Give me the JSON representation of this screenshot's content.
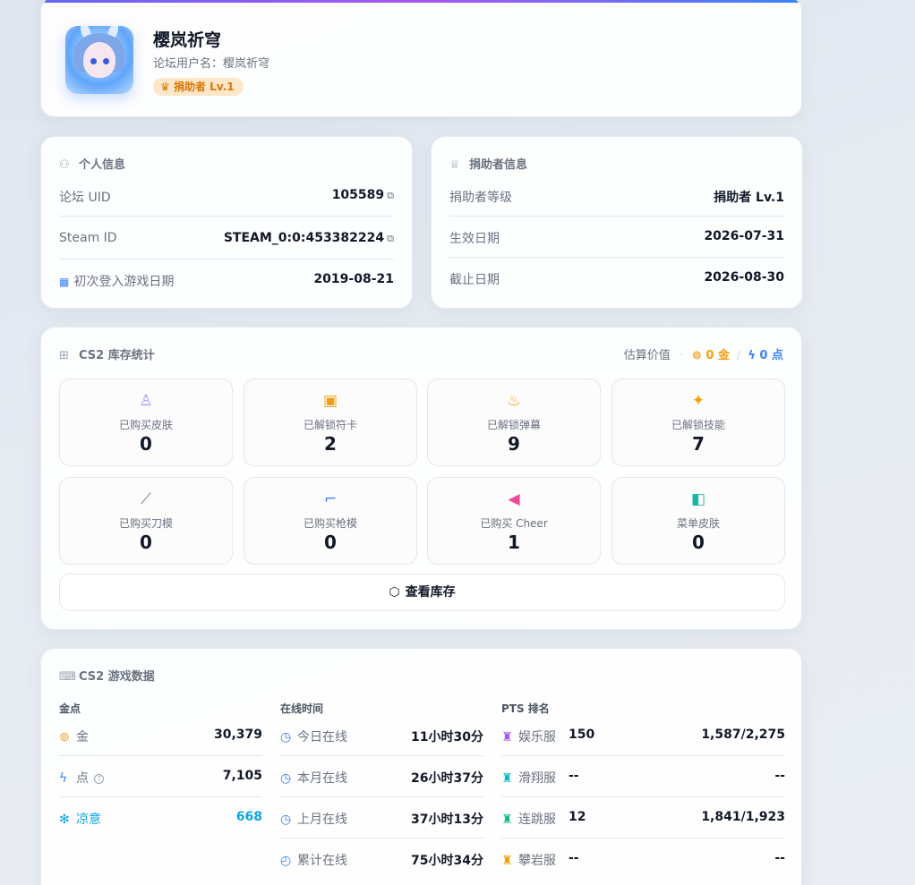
{
  "profile": {
    "username": "樱岚祈穹",
    "forum_name": "论坛用户名：樱岚祈穹",
    "badge": "捐助者 Lv.1"
  },
  "personal": {
    "title": "个人信息",
    "rows": [
      {
        "label": "论坛 UID",
        "value": "105589"
      },
      {
        "label": "Steam ID",
        "value": "STEAM_0:0:453382224"
      },
      {
        "label": "初次登入游戏日期",
        "value": "2019-08-21"
      }
    ]
  },
  "donor": {
    "title": "捐助者信息",
    "rows": [
      {
        "label": "捐助者等级",
        "value": "捐助者 Lv.1"
      },
      {
        "label": "生效日期",
        "value": "2026-07-31"
      },
      {
        "label": "截止日期",
        "value": "2026-08-30"
      }
    ]
  },
  "inventory": {
    "title": "CS2 库存统计",
    "estimate_label": "估算价值",
    "estimate_gold": "0 金",
    "estimate_points": "0 点",
    "tiles": [
      {
        "label": "已购买皮肤",
        "value": "0",
        "icon": "figure-icon",
        "color": "#a78bfa"
      },
      {
        "label": "已解锁符卡",
        "value": "2",
        "icon": "card-icon",
        "color": "#f59e0b"
      },
      {
        "label": "已解锁弹幕",
        "value": "9",
        "icon": "flame-icon",
        "color": "#f59e0b"
      },
      {
        "label": "已解锁技能",
        "value": "7",
        "icon": "sparkles-icon",
        "color": "#f59e0b"
      },
      {
        "label": "已购买刀模",
        "value": "0",
        "icon": "knife-icon",
        "color": "#6b7280"
      },
      {
        "label": "已购买枪模",
        "value": "0",
        "icon": "gun-icon",
        "color": "#3b82f6"
      },
      {
        "label": "已购买 Cheer",
        "value": "1",
        "icon": "megaphone-icon",
        "color": "#ec4899"
      },
      {
        "label": "菜单皮肤",
        "value": "0",
        "icon": "panel-icon",
        "color": "#14b8a6"
      }
    ],
    "view_button": "查看库存"
  },
  "game": {
    "title": "CS2 游戏数据",
    "currency": {
      "header": "金点",
      "rows": [
        {
          "label": "金",
          "value": "30,379",
          "color": "#f59e0b"
        },
        {
          "label": "点",
          "value": "7,105",
          "color": "#3b82f6"
        },
        {
          "label": "凉意",
          "value": "668",
          "color": "#0ea5e9"
        }
      ]
    },
    "online": {
      "header": "在线时间",
      "rows": [
        {
          "label": "今日在线",
          "value": "11小时30分"
        },
        {
          "label": "本月在线",
          "value": "26小时37分"
        },
        {
          "label": "上月在线",
          "value": "37小时13分"
        },
        {
          "label": "累计在线",
          "value": "75小时34分"
        }
      ]
    },
    "pts": {
      "header": "PTS 排名",
      "rows": [
        {
          "label": "娱乐服",
          "pts": "150",
          "rank": "1,587/2,275",
          "color": "#a855f7"
        },
        {
          "label": "滑翔服",
          "pts": "--",
          "rank": "--",
          "color": "#06b6d4"
        },
        {
          "label": "连跳服",
          "pts": "12",
          "rank": "1,841/1,923",
          "color": "#10b981"
        },
        {
          "label": "攀岩服",
          "pts": "--",
          "rank": "--",
          "color": "#f59e0b"
        }
      ]
    }
  }
}
